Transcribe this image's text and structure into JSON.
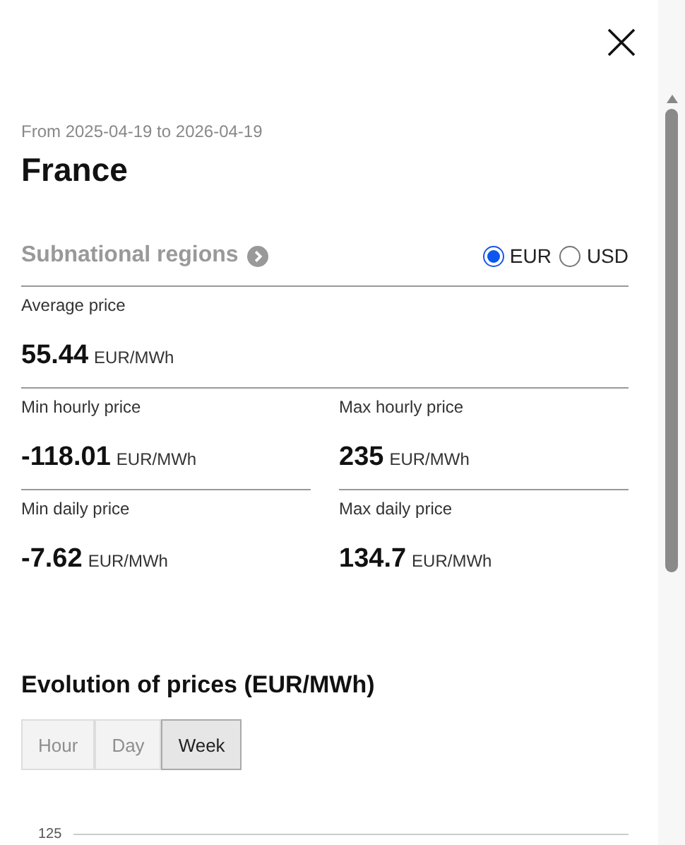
{
  "period": "From 2025-04-19 to 2026-04-19",
  "country": "France",
  "subnational_link": "Subnational regions",
  "currencies": [
    {
      "label": "EUR",
      "selected": true
    },
    {
      "label": "USD",
      "selected": false
    }
  ],
  "stats": [
    {
      "label": "Average price",
      "value": "55.44",
      "unit": "EUR/MWh"
    },
    {
      "label": "Min hourly price",
      "value": "-118.01",
      "unit": "EUR/MWh"
    },
    {
      "label": "Max hourly price",
      "value": "235",
      "unit": "EUR/MWh"
    },
    {
      "label": "Min daily price",
      "value": "-7.62",
      "unit": "EUR/MWh"
    },
    {
      "label": "Max daily price",
      "value": "134.7",
      "unit": "EUR/MWh"
    }
  ],
  "evolution": {
    "title": "Evolution of prices (EUR/MWh)",
    "granularity": [
      {
        "label": "Hour",
        "selected": false,
        "disabled": true
      },
      {
        "label": "Day",
        "selected": false,
        "disabled": true
      },
      {
        "label": "Week",
        "selected": true,
        "disabled": false
      }
    ],
    "axis_label": "125"
  }
}
